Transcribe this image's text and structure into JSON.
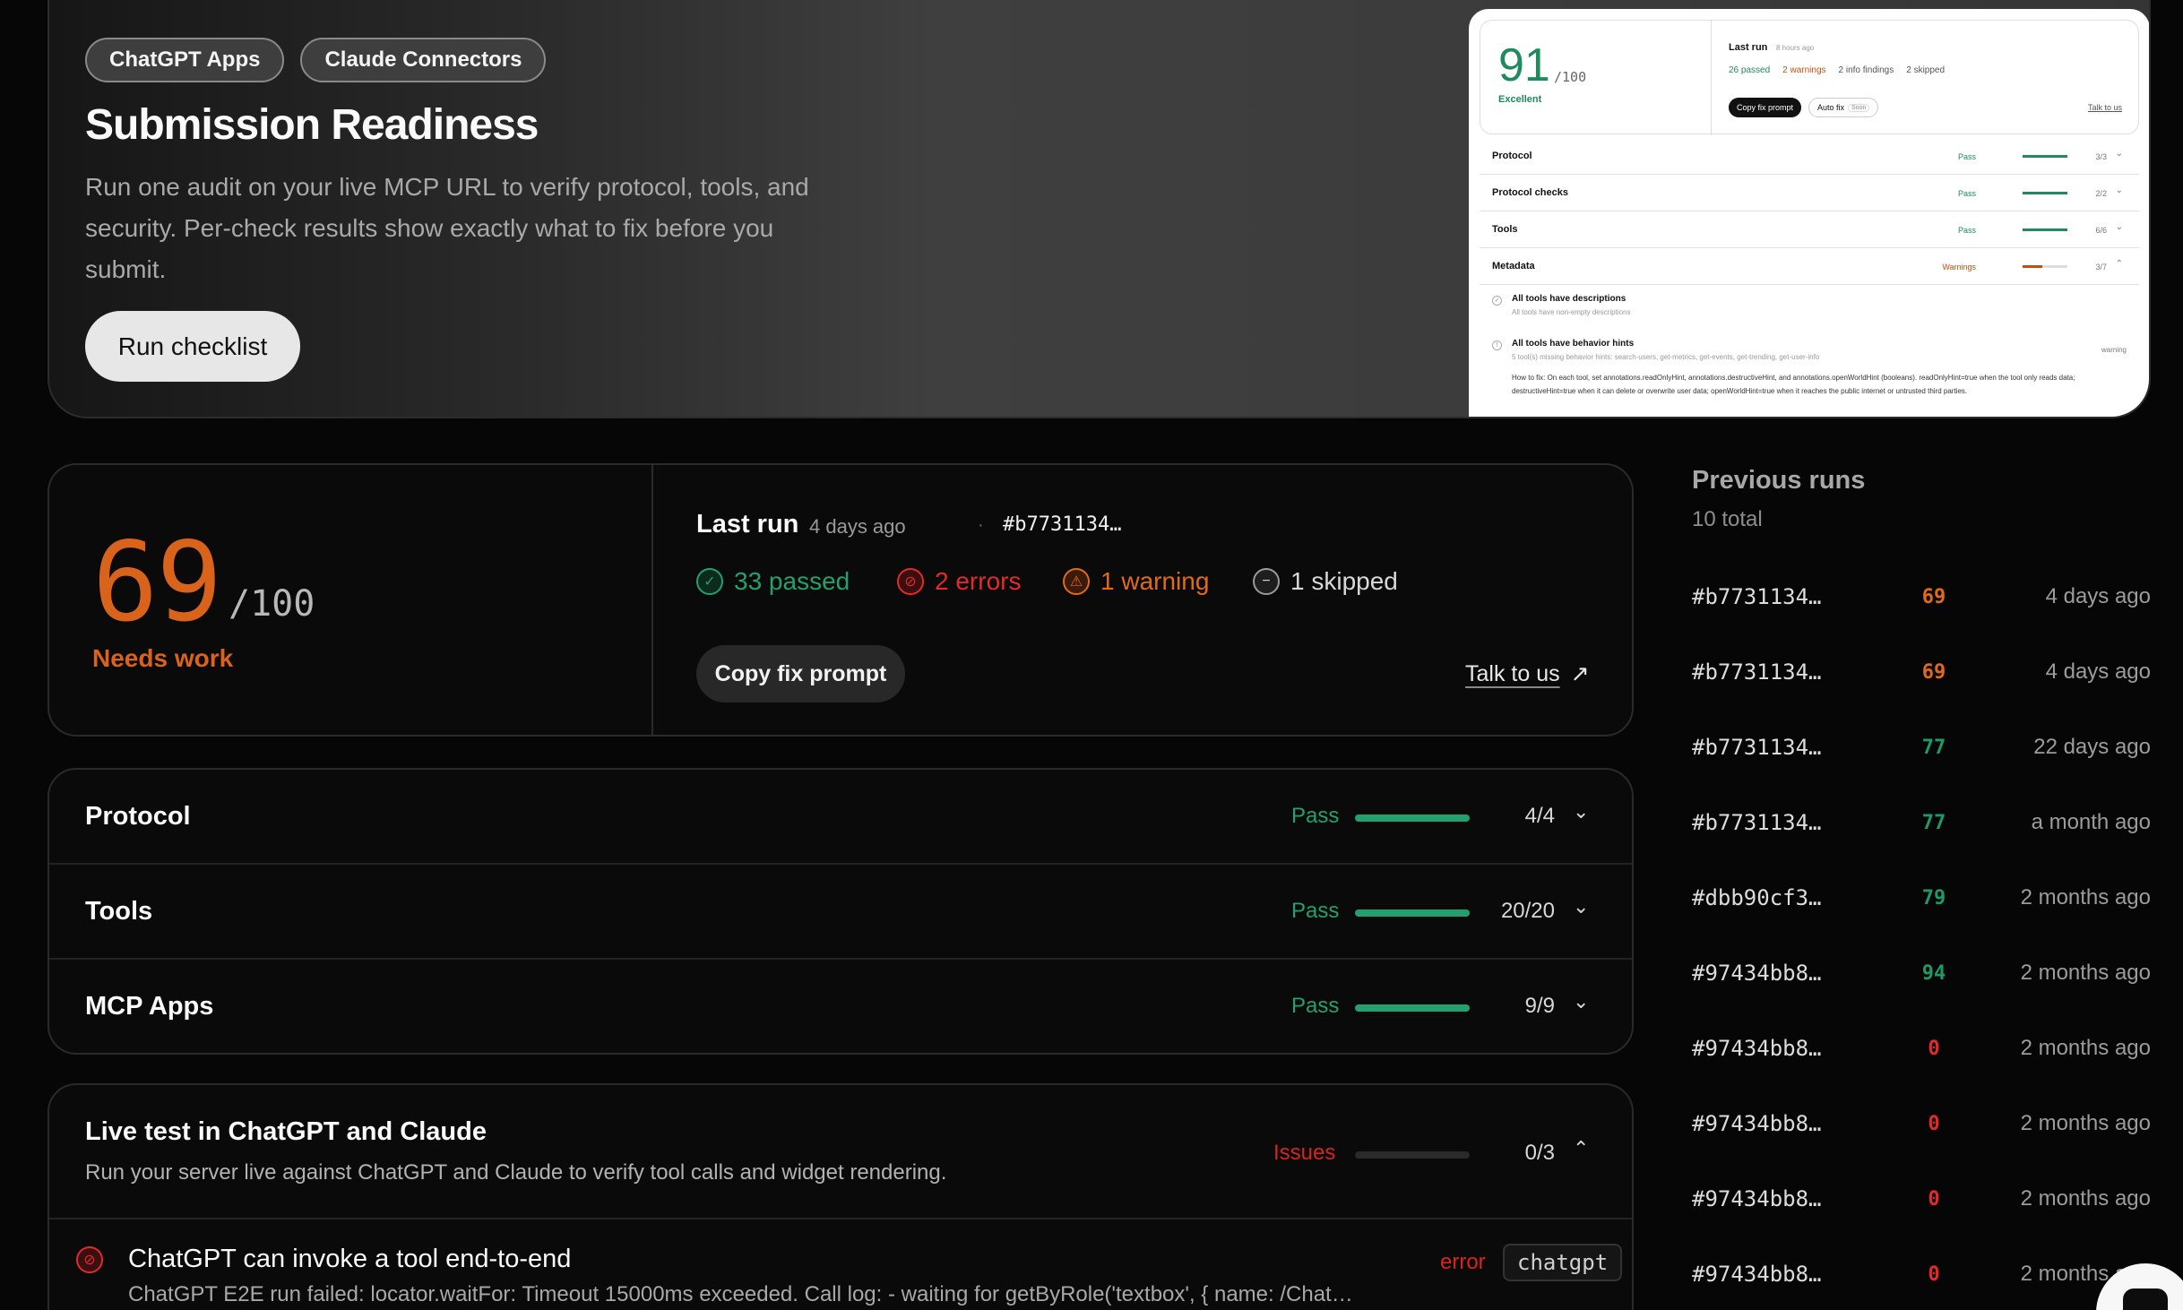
{
  "hero": {
    "pills": [
      "ChatGPT Apps",
      "Claude Connectors"
    ],
    "title": "Submission Readiness",
    "description": "Run one audit on your live MCP URL to verify protocol, tools, and security. Per-check results show exactly what to fix before you submit.",
    "run_button": "Run checklist"
  },
  "preview": {
    "score": "91",
    "score_of": "/100",
    "status": "Excellent",
    "last_run": "Last run",
    "ago": "8 hours ago",
    "stats": [
      "26 passed",
      "2 warnings",
      "2 info findings",
      "2 skipped"
    ],
    "copy": "Copy fix prompt",
    "auto_fix": "Auto fix",
    "soon": "Soon",
    "talk": "Talk to us",
    "rows": [
      {
        "name": "Protocol",
        "status": "Pass",
        "count": "3/3",
        "fill": 1.0,
        "warn": false
      },
      {
        "name": "Protocol checks",
        "status": "Pass",
        "count": "2/2",
        "fill": 1.0,
        "warn": false
      },
      {
        "name": "Tools",
        "status": "Pass",
        "count": "6/6",
        "fill": 1.0,
        "warn": false
      },
      {
        "name": "Metadata",
        "status": "Warnings",
        "count": "3/7",
        "fill": 0.43,
        "warn": true
      }
    ],
    "check1_title": "All tools have descriptions",
    "check1_sub": "All tools have non-empty descriptions",
    "check2_title": "All tools have behavior hints",
    "check2_sub": "5 tool(s) missing behavior hints: search-users, get-metrics, get-events, get-trending, get-user-info",
    "check2_badge": "warning",
    "fix_text": "How to fix: On each tool, set annotations.readOnlyHint, annotations.destructiveHint, and annotations.openWorldHint (booleans). readOnlyHint=true when the tool only reads data; destructiveHint=true when it can delete or overwrite user data; openWorldHint=true when it reaches the public internet or untrusted third parties."
  },
  "score_card": {
    "score": "69",
    "score_of": "/100",
    "status": "Needs work",
    "last_run_label": "Last run",
    "last_run_ago": "4 days ago",
    "separator": "·",
    "run_hash": "#b7731134…",
    "passed": "33 passed",
    "errors": "2 errors",
    "warnings": "1 warning",
    "skipped": "1 skipped",
    "copy_button": "Copy fix prompt",
    "talk_link": "Talk to us"
  },
  "categories": [
    {
      "name": "Protocol",
      "status": "Pass",
      "count": "4/4",
      "fill": 1.0
    },
    {
      "name": "Tools",
      "status": "Pass",
      "count": "20/20",
      "fill": 1.0
    },
    {
      "name": "MCP Apps",
      "status": "Pass",
      "count": "9/9",
      "fill": 1.0
    }
  ],
  "live_test": {
    "title": "Live test in ChatGPT and Claude",
    "description": "Run your server live against ChatGPT and Claude to verify tool calls and widget rendering.",
    "status": "Issues",
    "count": "0/3",
    "fill": 0.0,
    "item": {
      "title": "ChatGPT can invoke a tool end-to-end",
      "detail": "ChatGPT E2E run failed: locator.waitFor: Timeout 15000ms exceeded. Call log: - waiting for getByRole('textbox', { name: /Chat…",
      "level": "error",
      "tag": "chatgpt"
    }
  },
  "previous_runs": {
    "title": "Previous runs",
    "total": "10 total",
    "runs": [
      {
        "hash": "#b7731134…",
        "score": "69",
        "color": "#e06a1b",
        "ago": "4 days ago"
      },
      {
        "hash": "#b7731134…",
        "score": "69",
        "color": "#e06a1b",
        "ago": "4 days ago"
      },
      {
        "hash": "#b7731134…",
        "score": "77",
        "color": "#1e9a68",
        "ago": "22 days ago"
      },
      {
        "hash": "#b7731134…",
        "score": "77",
        "color": "#1e9a68",
        "ago": "a month ago"
      },
      {
        "hash": "#dbb90cf3…",
        "score": "79",
        "color": "#1e9a68",
        "ago": "2 months ago"
      },
      {
        "hash": "#97434bb8…",
        "score": "94",
        "color": "#1e9a68",
        "ago": "2 months ago"
      },
      {
        "hash": "#97434bb8…",
        "score": "0",
        "color": "#e2292b",
        "ago": "2 months ago"
      },
      {
        "hash": "#97434bb8…",
        "score": "0",
        "color": "#e2292b",
        "ago": "2 months ago"
      },
      {
        "hash": "#97434bb8…",
        "score": "0",
        "color": "#e2292b",
        "ago": "2 months ago"
      },
      {
        "hash": "#97434bb8…",
        "score": "0",
        "color": "#e2292b",
        "ago": "2 months ago"
      }
    ]
  },
  "colors": {
    "pass": "#23a06d",
    "error": "#e2292b",
    "warning": "#e06a1b",
    "needs_work": "#d9631a"
  }
}
